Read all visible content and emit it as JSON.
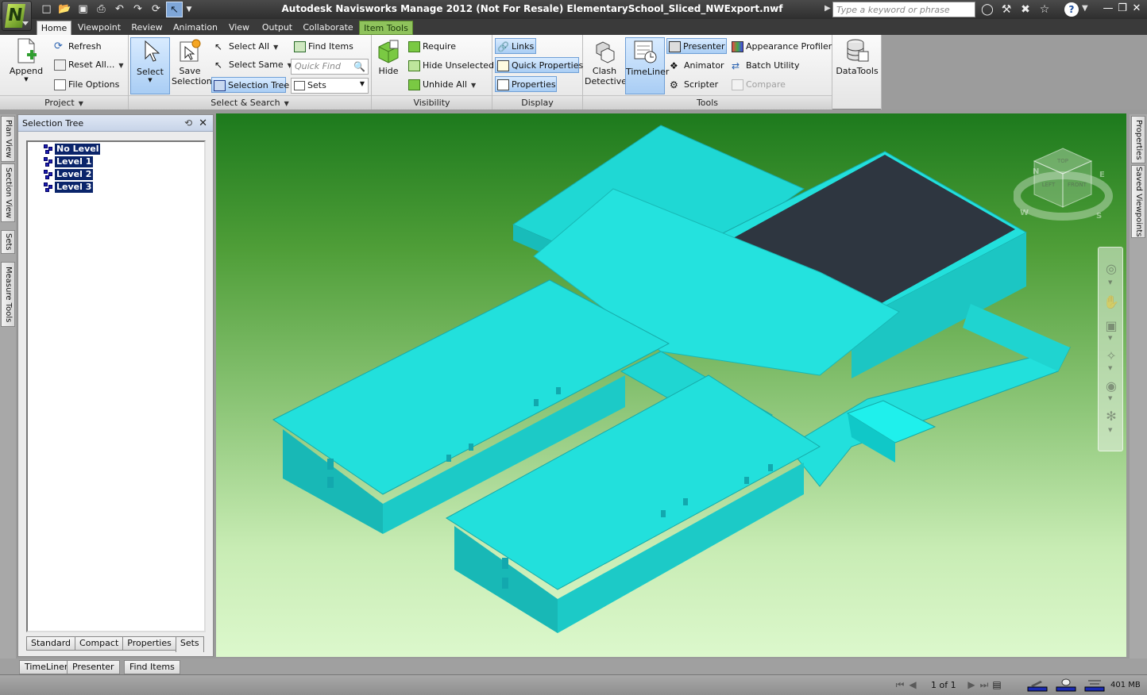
{
  "window": {
    "title": "Autodesk Navisworks Manage 2012 (Not For Resale)   ElementarySchool_Sliced_NWExport.nwf",
    "search_placeholder": "Type a keyword or phrase"
  },
  "ribbon_tabs": [
    {
      "label": "Home",
      "state": "active"
    },
    {
      "label": "Viewpoint"
    },
    {
      "label": "Review"
    },
    {
      "label": "Animation"
    },
    {
      "label": "View"
    },
    {
      "label": "Output"
    },
    {
      "label": "Collaborate"
    },
    {
      "label": "Item Tools",
      "state": "contextual"
    }
  ],
  "panels": {
    "project": {
      "title": "Project",
      "append": "Append",
      "refresh": "Refresh",
      "reset_all": "Reset All...",
      "file_options": "File Options"
    },
    "select_search": {
      "title": "Select & Search",
      "select": "Select",
      "save_selection_line1": "Save",
      "save_selection_line2": "Selection",
      "select_all": "Select All",
      "select_same": "Select Same",
      "selection_tree": "Selection Tree",
      "find_items": "Find Items",
      "quick_find_placeholder": "Quick Find",
      "sets": "Sets"
    },
    "visibility": {
      "title": "Visibility",
      "hide": "Hide",
      "require": "Require",
      "hide_unselected": "Hide Unselected",
      "unhide_all": "Unhide All"
    },
    "display": {
      "title": "Display",
      "links": "Links",
      "quick_properties": "Quick Properties",
      "properties": "Properties"
    },
    "tools": {
      "title": "Tools",
      "clash_detective_line1": "Clash",
      "clash_detective_line2": "Detective",
      "timeliner": "TimeLiner",
      "presenter": "Presenter",
      "animator": "Animator",
      "scripter": "Scripter",
      "appearance_profiler": "Appearance Profiler",
      "batch_utility": "Batch Utility",
      "compare": "Compare"
    },
    "datatools": {
      "label": "DataTools"
    }
  },
  "left_vertical_tabs": [
    "Plan View",
    "Section View",
    "Sets",
    "Measure Tools"
  ],
  "selection_tree": {
    "title": "Selection Tree",
    "items": [
      "No Level",
      "Level 1",
      "Level 2",
      "Level 3"
    ],
    "tabs": [
      "Standard",
      "Compact",
      "Properties",
      "Sets"
    ],
    "active_tab": "Sets"
  },
  "right_vertical_tabs": [
    "Properties",
    "Saved Viewpoints"
  ],
  "navcube": {
    "faces": [
      "TOP",
      "LEFT",
      "FRONT"
    ],
    "compass": [
      "N",
      "W",
      "S",
      "E"
    ]
  },
  "dock_tabs": [
    "TimeLiner",
    "Presenter",
    "Find Items"
  ],
  "status": {
    "page": "1 of 1",
    "memory": "401 MB"
  },
  "colors": {
    "building": "#22e0dc",
    "roof_dark": "#2e3640",
    "viewport_top": "#1d7a1d",
    "viewport_bottom": "#dcf8cc",
    "selection_highlight": "#0a246a"
  }
}
